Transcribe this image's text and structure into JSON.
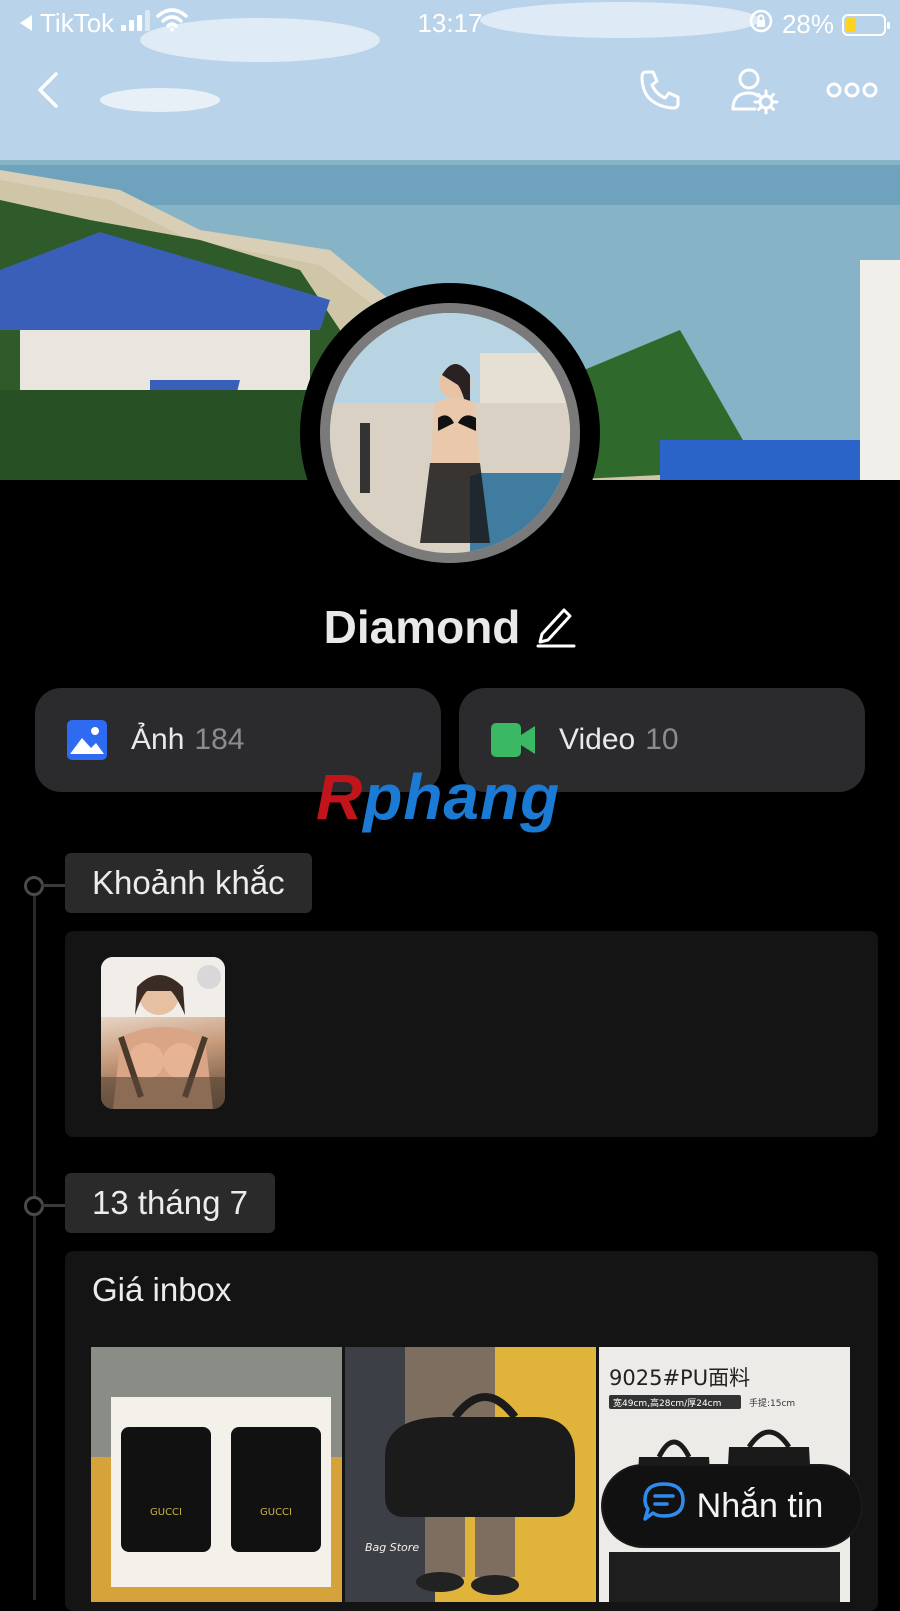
{
  "status_bar": {
    "back_app": "TikTok",
    "time": "13:17",
    "battery": "28%",
    "battery_level": 0.28
  },
  "profile": {
    "name": "Diamond"
  },
  "media": {
    "photos_label": "Ảnh",
    "photos_count": "184",
    "videos_label": "Video",
    "videos_count": "10"
  },
  "watermark": {
    "first": "R",
    "rest": "phang"
  },
  "timeline": {
    "moments_label": "Khoảnh khắc",
    "date_label": "13 tháng 7",
    "post_title": "Giá inbox",
    "post_images": [
      {
        "brand_text": "GUCCI"
      },
      {
        "caption": "Bag Store"
      },
      {
        "heading": "9025#PU面料",
        "spec": "宽49cm,高28cm/厚24cm",
        "handle": "手提:15cm"
      }
    ]
  },
  "actions": {
    "message_label": "Nhắn tin"
  },
  "colors": {
    "photo_icon": "#2f6bf0",
    "video_icon": "#3bb864",
    "message_icon": "#2e8cf0"
  }
}
